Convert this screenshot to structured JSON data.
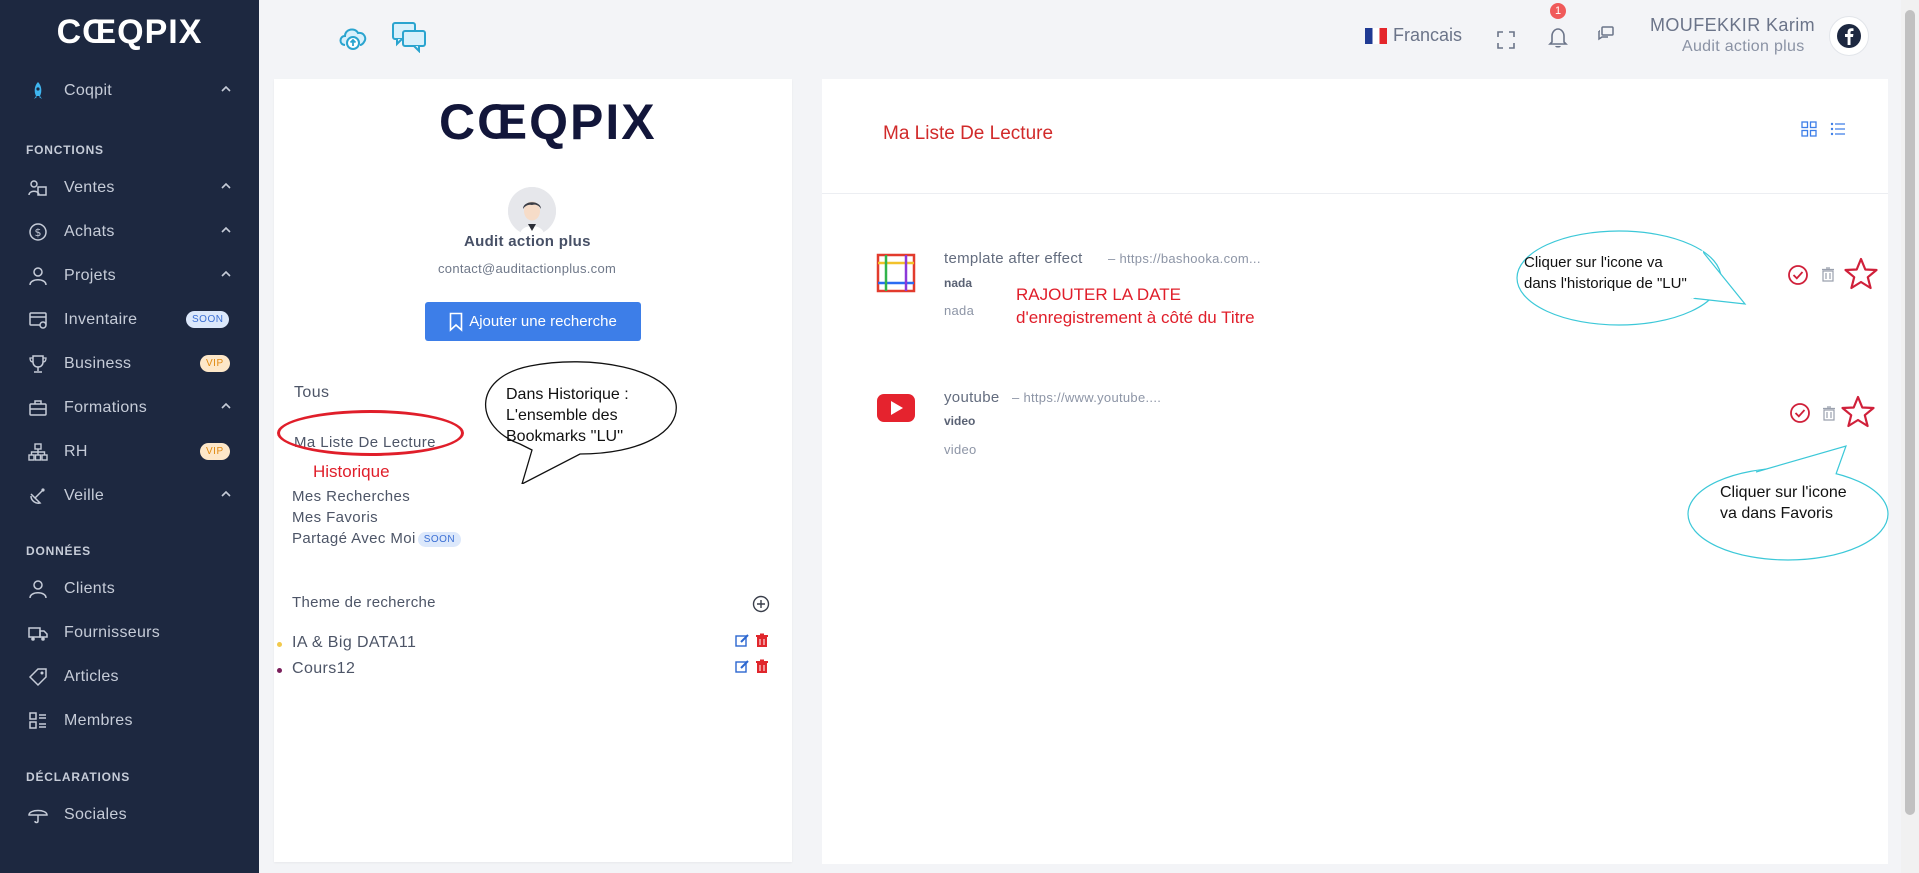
{
  "sidebar": {
    "logo": "CŒQPIX",
    "top_item": {
      "label": "Coqpit"
    },
    "sections": {
      "fonctions": "FONCTIONS",
      "donnees": "DONNÉES",
      "declarations": "DÉCLARATIONS"
    },
    "items": [
      {
        "label": "Ventes",
        "icon": "sales-icon"
      },
      {
        "label": "Achats",
        "icon": "dollar-icon"
      },
      {
        "label": "Projets",
        "icon": "user-icon"
      },
      {
        "label": "Inventaire",
        "icon": "inventory-icon",
        "badge": "SOON"
      },
      {
        "label": "Business",
        "icon": "trophy-icon",
        "badge": "VIP"
      },
      {
        "label": "Formations",
        "icon": "briefcase-icon"
      },
      {
        "label": "RH",
        "icon": "org-chart-icon",
        "badge": "VIP"
      },
      {
        "label": "Veille",
        "icon": "satellite-icon"
      },
      {
        "label": "Clients",
        "icon": "user-icon"
      },
      {
        "label": "Fournisseurs",
        "icon": "truck-icon"
      },
      {
        "label": "Articles",
        "icon": "tag-icon"
      },
      {
        "label": "Membres",
        "icon": "members-icon"
      },
      {
        "label": "Sociales",
        "icon": "umbrella-icon"
      }
    ]
  },
  "header": {
    "language": "Francais",
    "notification_count": "1",
    "user_name": "MOUFEKKIR Karim",
    "user_org": "Audit action plus"
  },
  "left_panel": {
    "logo": "CŒQPIX",
    "org_name": "Audit action plus",
    "org_email": "contact@auditactionplus.com",
    "add_button": "Ajouter une recherche",
    "menu": {
      "all": "Tous",
      "reading_list": "Ma Liste De Lecture",
      "searches": "Mes Recherches",
      "favorites": "Mes Favoris",
      "shared": "Partagé Avec Moi",
      "shared_badge": "SOON"
    },
    "theme_title": "Theme de recherche",
    "themes": [
      {
        "label": "IA & Big DATA11",
        "color": "#f2c94c"
      },
      {
        "label": "Cours12",
        "color": "#7a1f5c"
      }
    ]
  },
  "right_panel": {
    "title": "Ma Liste De Lecture",
    "items": [
      {
        "title": "template after effect",
        "url": "https://bashooka.com...",
        "sub": "nada",
        "sub2": "nada"
      },
      {
        "title": "youtube",
        "url": "https://www.youtube....",
        "sub": "video",
        "sub2": "video"
      }
    ]
  },
  "annotations": {
    "historique": "Historique",
    "bubble_historique": [
      "Dans Historique :",
      "L'ensemble des",
      "Bookmarks ''LU''"
    ],
    "rajouter": [
      "RAJOUTER LA DATE",
      "d'enregistrement à côté du Titre"
    ],
    "bubble_lu": [
      "Cliquer sur l'icone va",
      "dans l'historique de \"LU\""
    ],
    "bubble_favoris": [
      "Cliquer sur l'icone",
      "va dans Favoris"
    ]
  },
  "colors": {
    "sidebar_bg": "#1d2840",
    "accent_blue": "#3d7ee8",
    "annotation_red": "#e01e2a",
    "star_red": "#d0203a",
    "bubble_cyan": "#3cc8d8"
  }
}
